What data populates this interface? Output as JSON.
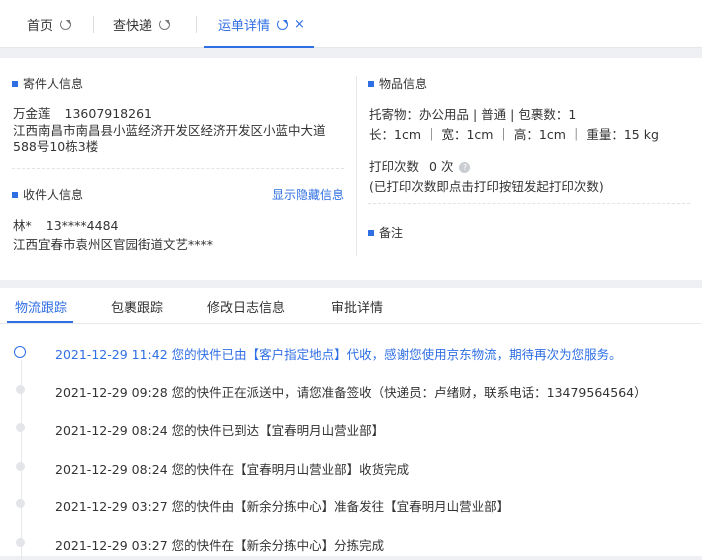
{
  "tabs": [
    {
      "label": "首页"
    },
    {
      "label": "查快递"
    },
    {
      "label": "运单详情",
      "close": "×"
    }
  ],
  "sender": {
    "title": "寄件人信息",
    "name": "万金莲",
    "phone": "13607918261",
    "address": "江西南昌市南昌县小蓝经济开发区经济开发区小蓝中大道588号10栋3楼"
  },
  "receiver": {
    "title": "收件人信息",
    "show_hidden": "显示隐藏信息",
    "name": "林*",
    "phone": "13****4484",
    "address": "江西宜春市袁州区官园街道文艺****"
  },
  "goods": {
    "title": "物品信息",
    "line1": "托寄物：办公用品 | 普通 | 包裹数：1",
    "line2": "长：1cm ｜ 宽：1cm ｜ 高：1cm ｜ 重量：15 kg",
    "print_label": "打印次数",
    "print_count": "0 次",
    "print_note": "(已打印次数即点击打印按钮发起打印次数)"
  },
  "remark": {
    "title": "备注"
  },
  "tracking_tabs": [
    {
      "label": "物流跟踪"
    },
    {
      "label": "包裹跟踪"
    },
    {
      "label": "修改日志信息"
    },
    {
      "label": "审批详情"
    }
  ],
  "events": [
    {
      "text": "2021-12-29 11:42 您的快件已由【客户指定地点】代收，感谢您使用京东物流，期待再次为您服务。"
    },
    {
      "text": "2021-12-29 09:28 您的快件正在派送中，请您准备签收（快递员：卢绪财，联系电话：13479564564）"
    },
    {
      "text": "2021-12-29 08:24 您的快件已到达【宜春明月山营业部】"
    },
    {
      "text": "2021-12-29 08:24 您的快件在【宜春明月山营业部】收货完成"
    },
    {
      "text": "2021-12-29 03:27 您的快件由【新余分拣中心】准备发往【宜春明月山营业部】"
    },
    {
      "text": "2021-12-29 03:27 您的快件在【新余分拣中心】分拣完成"
    }
  ],
  "colors": {
    "accent": "#2f6fe4",
    "background": "#eef0f3"
  }
}
